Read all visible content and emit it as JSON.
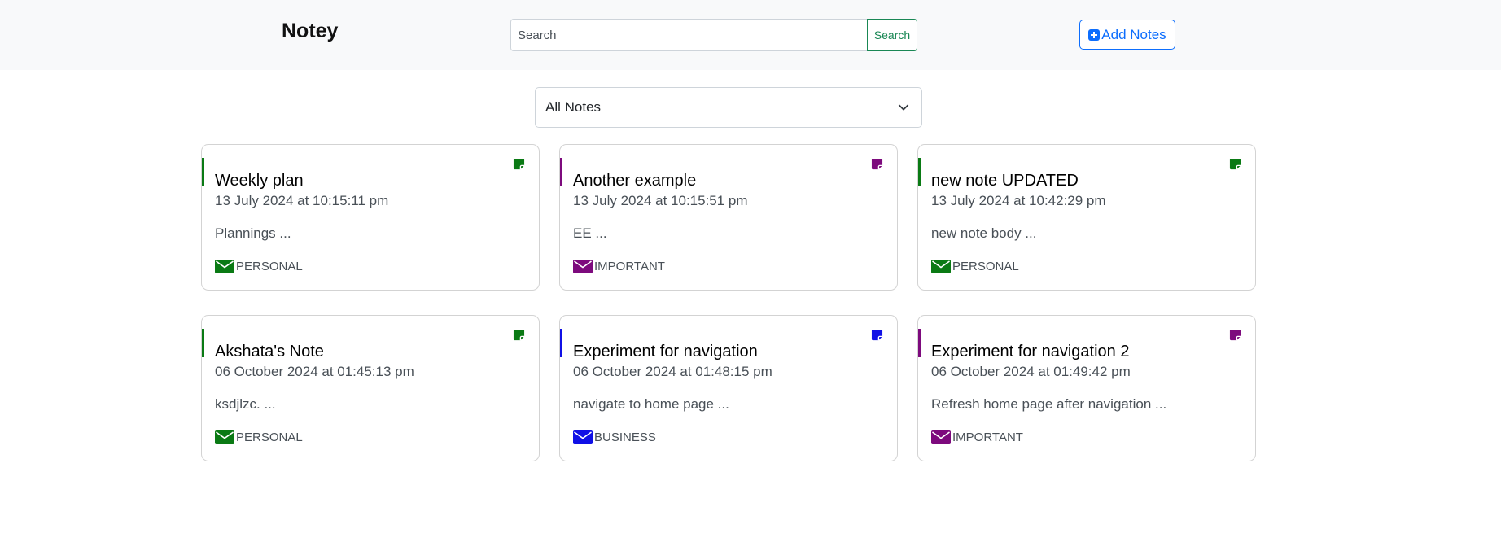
{
  "header": {
    "brand": "Notey",
    "search_placeholder": "Search",
    "search_button": "Search",
    "add_button": "Add Notes"
  },
  "filter": {
    "selected": "All Notes",
    "icon": "chevron-down-icon"
  },
  "colors": {
    "PERSONAL": "#0a7a14",
    "IMPORTANT": "#7d0a7d",
    "BUSINESS": "#1010e6",
    "accent": "#0d6efd",
    "search": "#198754"
  },
  "notes": [
    {
      "title": "Weekly plan",
      "date": "13 July 2024 at 10:15:11 pm",
      "body": "Plannings ...",
      "category": "PERSONAL"
    },
    {
      "title": "Another example",
      "date": "13 July 2024 at 10:15:51 pm",
      "body": "EE ...",
      "category": "IMPORTANT"
    },
    {
      "title": "new note UPDATED",
      "date": "13 July 2024 at 10:42:29 pm",
      "body": "new note body ...",
      "category": "PERSONAL"
    },
    {
      "title": "Akshata's Note",
      "date": "06 October 2024 at 01:45:13 pm",
      "body": "ksdjlzc. ...",
      "category": "PERSONAL"
    },
    {
      "title": "Experiment for navigation",
      "date": "06 October 2024 at 01:48:15 pm",
      "body": "navigate to home page ...",
      "category": "BUSINESS"
    },
    {
      "title": "Experiment for navigation 2",
      "date": "06 October 2024 at 01:49:42 pm",
      "body": "Refresh home page after navigation ...",
      "category": "IMPORTANT"
    }
  ]
}
